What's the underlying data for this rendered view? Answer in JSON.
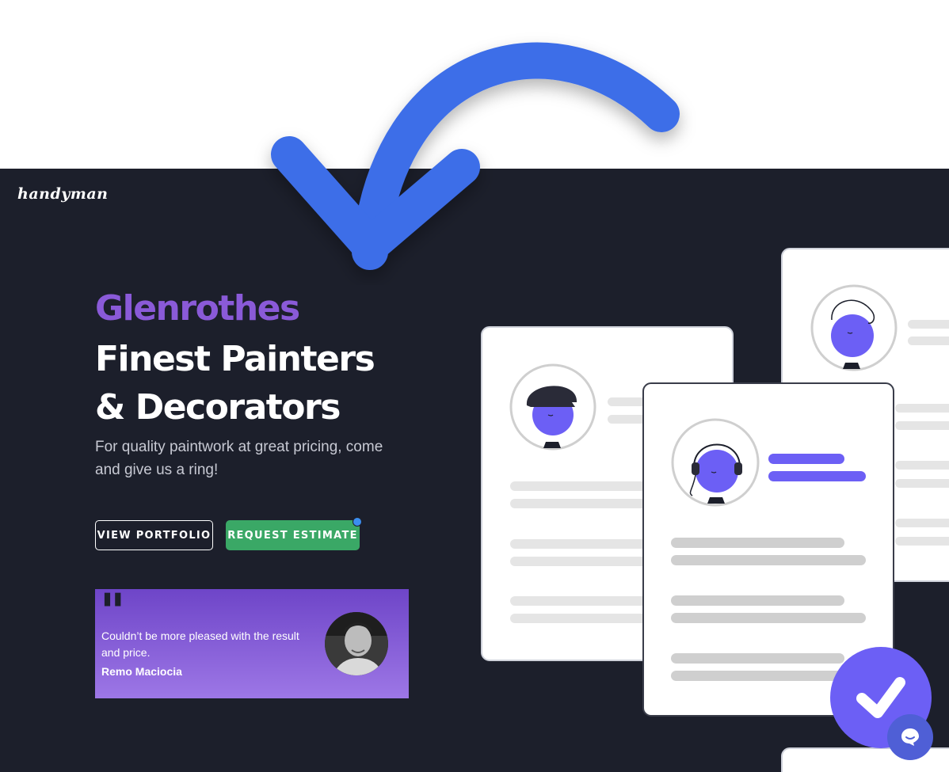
{
  "brand": {
    "logo_text": "handyman"
  },
  "hero": {
    "headline_accent": "Glenrothes",
    "headline_line1": "Finest Painters",
    "headline_line2": "& Decorators",
    "subtitle": "For quality paintwork at great pricing, come and give us a ring!"
  },
  "buttons": {
    "portfolio_label": "VIEW PORTFOLIO",
    "estimate_label": "REQUEST ESTIMATE"
  },
  "testimonial": {
    "quote": "Couldn’t be more pleased with the result and price.",
    "author": "Remo Maciocia"
  },
  "icons": {
    "arrow": "curved-arrow-icon",
    "check": "check-icon",
    "chat": "chat-icon"
  },
  "colors": {
    "hero_bg": "#1c1f2b",
    "accent_purple": "#8a5ad8",
    "arrow_blue": "#3c6ee8",
    "estimate_green": "#3aa866",
    "illus_purple": "#6c5ff5"
  }
}
